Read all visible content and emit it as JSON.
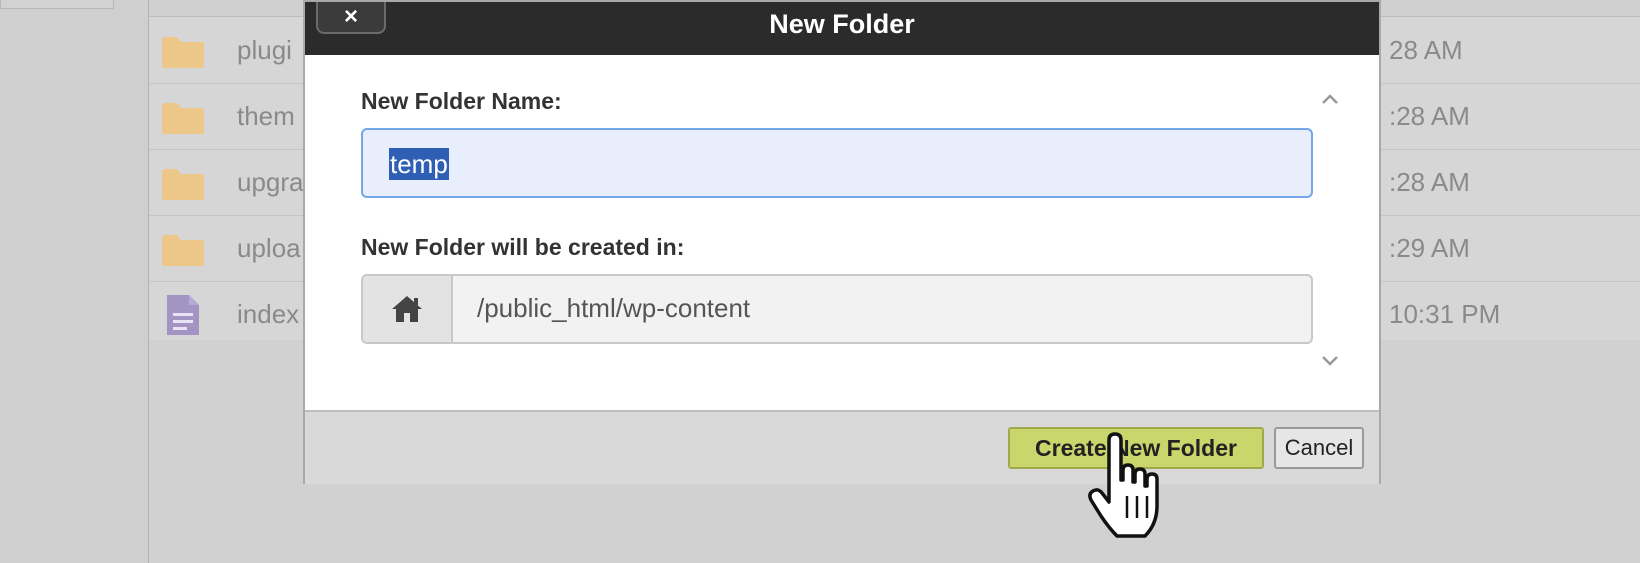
{
  "background": {
    "files": [
      {
        "name": "plugi",
        "time": "28 AM",
        "icon": "folder-icon"
      },
      {
        "name": "them",
        "time": ":28 AM",
        "icon": "folder-icon"
      },
      {
        "name": "upgra",
        "time": ":28 AM",
        "icon": "folder-icon"
      },
      {
        "name": "uploa",
        "time": ":29 AM",
        "icon": "folder-icon"
      },
      {
        "name": "index",
        "time": "10:31 PM",
        "icon": "file-icon"
      }
    ]
  },
  "dialog": {
    "title": "New Folder",
    "close_label": "×",
    "name_label": "New Folder Name:",
    "name_value": "temp",
    "path_label": "New Folder will be created in:",
    "path_value": "/public_html/wp-content",
    "path_icon": "home-icon",
    "create_label": "Create New Folder",
    "cancel_label": "Cancel"
  },
  "colors": {
    "header_bg": "#2b2b2b",
    "create_button": "#c9d66b",
    "folder_icon": "#f0c47b",
    "file_icon": "#9a88c0",
    "input_focus_border": "#74a7e6"
  }
}
